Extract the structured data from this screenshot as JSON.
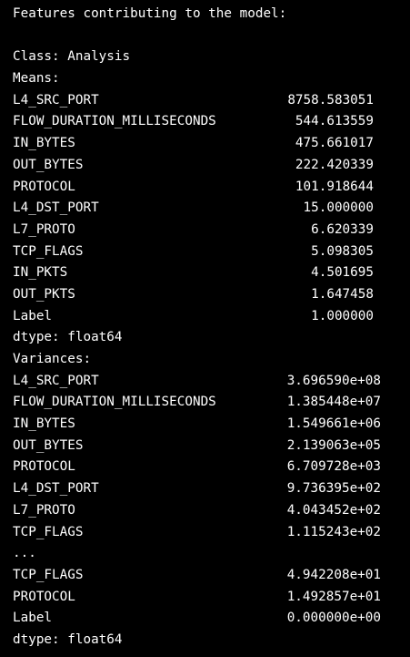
{
  "output": {
    "header": "Features contributing to the model:",
    "class_line": "Class: Analysis",
    "means_header": "Means:",
    "means": [
      {
        "name": "L4_SRC_PORT",
        "value": "8758.583051"
      },
      {
        "name": "FLOW_DURATION_MILLISECONDS",
        "value": "544.613559"
      },
      {
        "name": "IN_BYTES",
        "value": "475.661017"
      },
      {
        "name": "OUT_BYTES",
        "value": "222.420339"
      },
      {
        "name": "PROTOCOL",
        "value": "101.918644"
      },
      {
        "name": "L4_DST_PORT",
        "value": "15.000000"
      },
      {
        "name": "L7_PROTO",
        "value": "6.620339"
      },
      {
        "name": "TCP_FLAGS",
        "value": "5.098305"
      },
      {
        "name": "IN_PKTS",
        "value": "4.501695"
      },
      {
        "name": "OUT_PKTS",
        "value": "1.647458"
      },
      {
        "name": "Label",
        "value": "1.000000"
      }
    ],
    "means_dtype": "dtype: float64",
    "variances_header": "Variances:",
    "variances_top": [
      {
        "name": "L4_SRC_PORT",
        "value": "3.696590e+08"
      },
      {
        "name": "FLOW_DURATION_MILLISECONDS",
        "value": "1.385448e+07"
      },
      {
        "name": "IN_BYTES",
        "value": "1.549661e+06"
      },
      {
        "name": "OUT_BYTES",
        "value": "2.139063e+05"
      },
      {
        "name": "PROTOCOL",
        "value": "6.709728e+03"
      },
      {
        "name": "L4_DST_PORT",
        "value": "9.736395e+02"
      },
      {
        "name": "L7_PROTO",
        "value": "4.043452e+02"
      },
      {
        "name": "TCP_FLAGS",
        "value": "1.115243e+02"
      }
    ],
    "ellipsis": "...",
    "variances_bottom": [
      {
        "name": "TCP_FLAGS",
        "value": "4.942208e+01"
      },
      {
        "name": "PROTOCOL",
        "value": "1.492857e+01"
      },
      {
        "name": "Label",
        "value": "0.000000e+00"
      }
    ],
    "variances_dtype": "dtype: float64"
  },
  "colors": {
    "background": "#000000",
    "text": "#ffffff"
  }
}
